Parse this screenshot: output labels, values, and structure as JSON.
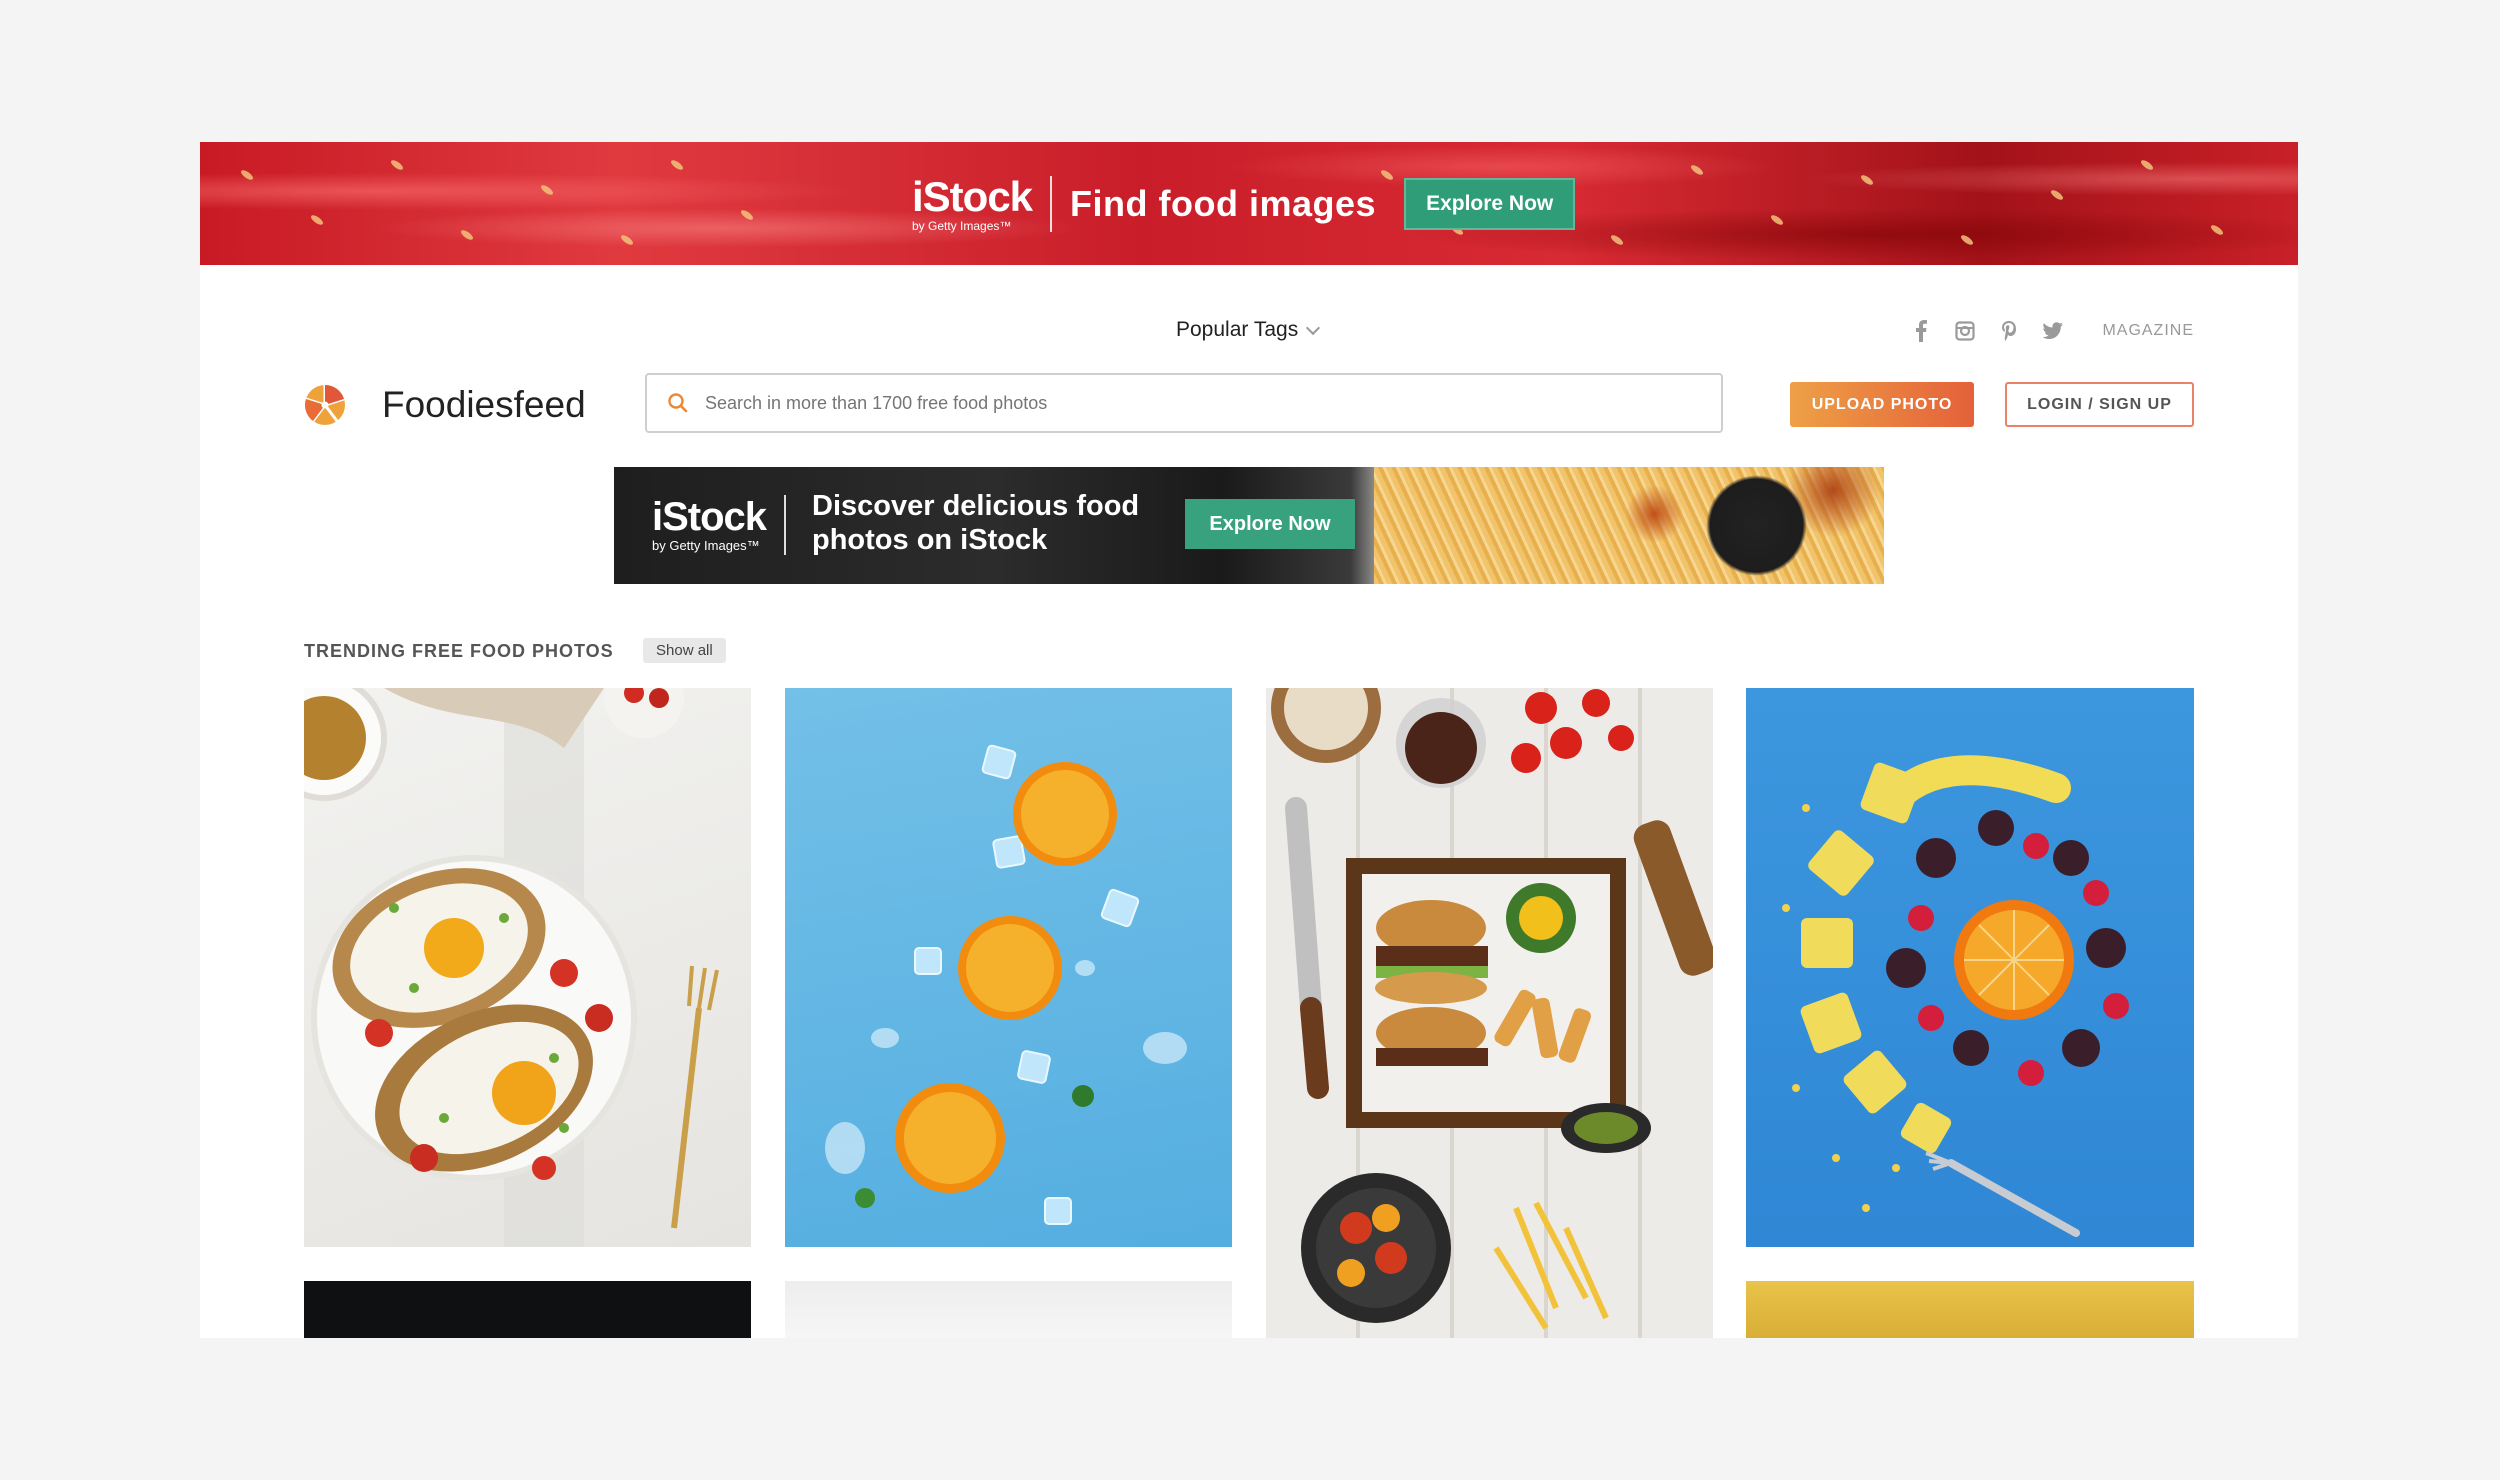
{
  "top_ad": {
    "brand": "iStock",
    "brand_sub": "by Getty Images™",
    "headline": "Find food images",
    "cta": "Explore Now"
  },
  "header": {
    "popular_tags": "Popular Tags",
    "social_icons": [
      "facebook-icon",
      "instagram-icon",
      "pinterest-icon",
      "twitter-icon"
    ],
    "magazine": "MAGAZINE",
    "logo_text": "Foodiesfeed",
    "search_placeholder": "Search in more than 1700 free food photos",
    "upload_label": "UPLOAD PHOTO",
    "login_label": "LOGIN / SIGN UP"
  },
  "mid_ad": {
    "brand": "iStock",
    "brand_sub": "by Getty Images™",
    "copy": "Discover delicious food photos on iStock",
    "cta": "Explore Now"
  },
  "trending": {
    "title": "TRENDING FREE FOOD PHOTOS",
    "show_all": "Show all"
  },
  "colors": {
    "accent_orange": "#eea046",
    "accent_red": "#e4613a",
    "istock_green": "#2f9e78"
  }
}
